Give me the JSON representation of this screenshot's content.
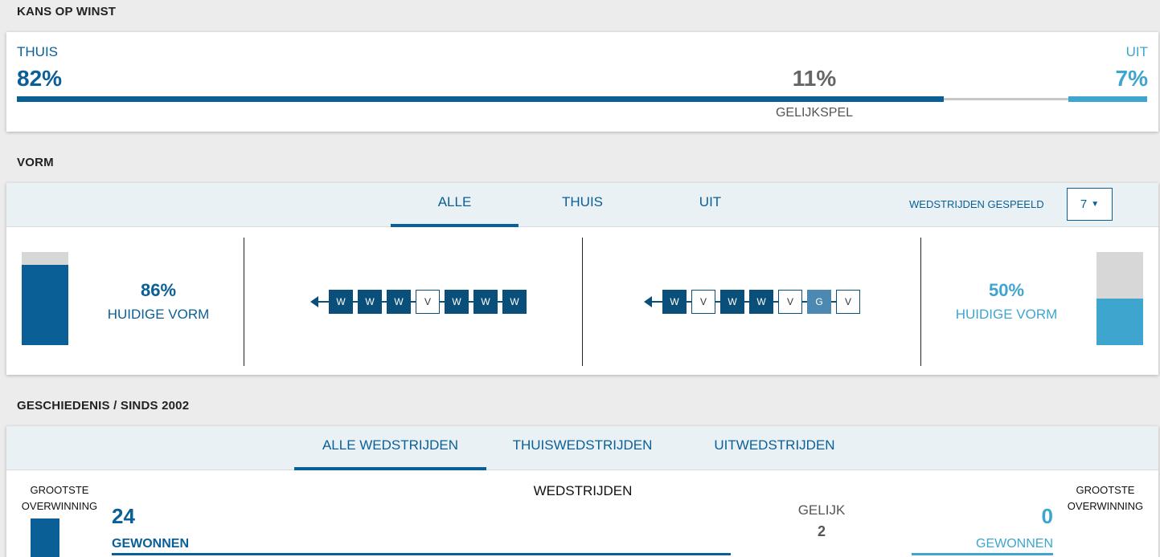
{
  "winkans": {
    "title": "KANS OP WINST",
    "home": {
      "label": "THUIS",
      "pct": "82%",
      "value": 82
    },
    "draw": {
      "label": "GELIJKSPEL",
      "pct": "11%",
      "value": 11
    },
    "away": {
      "label": "UIT",
      "pct": "7%",
      "value": 7
    }
  },
  "vorm": {
    "title": "VORM",
    "tabs": [
      {
        "label": "ALLE"
      },
      {
        "label": "THUIS"
      },
      {
        "label": "UIT"
      }
    ],
    "played_label": "WEDSTRIJDEN GESPEELD",
    "played_value": "7",
    "home": {
      "pct": "86%",
      "value": 86,
      "label": "HUIDIGE VORM",
      "results": [
        "W",
        "W",
        "W",
        "V",
        "W",
        "W",
        "W"
      ]
    },
    "away": {
      "pct": "50%",
      "value": 50,
      "label": "HUIDIGE VORM",
      "results": [
        "W",
        "V",
        "W",
        "W",
        "V",
        "G",
        "V"
      ]
    }
  },
  "geschiedenis": {
    "title": "GESCHIEDENIS / SINDS 2002",
    "tabs": [
      {
        "label": "ALLE WEDSTRIJDEN"
      },
      {
        "label": "THUISWEDSTRIJDEN"
      },
      {
        "label": "UITWEDSTRIJDEN"
      }
    ],
    "biggest_win_label_line1": "GROOTSTE",
    "biggest_win_label_line2": "OVERWINNING",
    "matches_label": "WEDSTRIJDEN",
    "home_won": "24",
    "home_won_label": "GEWONNEN",
    "draw_label": "GELIJK",
    "draw_value": "2",
    "away_won": "0",
    "away_won_label": "GEWONNEN"
  },
  "colors": {
    "home": "#0a5f96",
    "away": "#3ea5cf",
    "draw_bar": "#c8c8c8",
    "win_pill": "#0a4f7a",
    "draw_pill": "#4d88b1"
  }
}
